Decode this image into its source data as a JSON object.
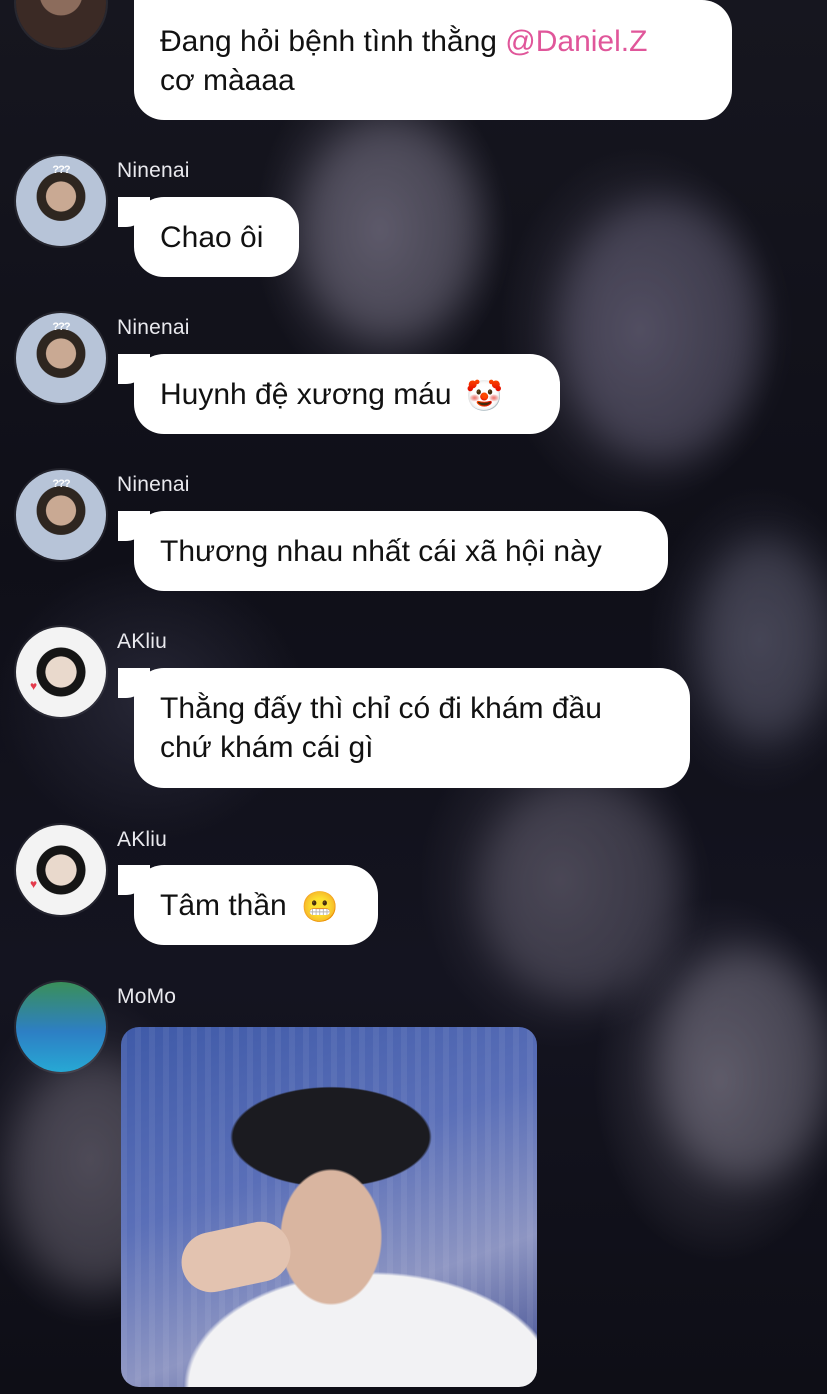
{
  "messages": [
    {
      "sender": "",
      "avatar": "top-avatar",
      "text_before": "Đang hỏi bệnh tình thằng ",
      "mention": "@Daniel.Z",
      "text_after": "cơ màaaa"
    },
    {
      "sender": "Ninenai",
      "avatar": "ninenai-avatar",
      "text": "Chao ôi"
    },
    {
      "sender": "Ninenai",
      "avatar": "ninenai-avatar",
      "text": "Huynh đệ xương máu",
      "emoji": "🤡"
    },
    {
      "sender": "Ninenai",
      "avatar": "ninenai-avatar",
      "text": "Thương nhau nhất cái xã hội này"
    },
    {
      "sender": "AKliu",
      "avatar": "akliu-avatar",
      "line1": "Thằng đấy thì chỉ có đi khám đầu",
      "line2": "chứ khám cái gì"
    },
    {
      "sender": "AKliu",
      "avatar": "akliu-avatar",
      "text": "Tâm thần",
      "emoji": "😬"
    },
    {
      "sender": "MoMo",
      "avatar": "momo-avatar",
      "image": "photo-message"
    }
  ],
  "avatar_badges": {
    "ninenai": "???"
  },
  "colors": {
    "bubble": "#ffffff",
    "mention": "#e0569a",
    "sender": "#e9e9ee",
    "background": "#0d0d16"
  }
}
